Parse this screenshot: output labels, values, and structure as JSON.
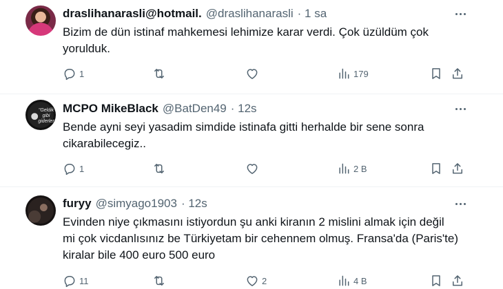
{
  "tweets": [
    {
      "name": "draslihanarasli@hotmail.",
      "handle": "@draslihanarasli",
      "time": "· 1 sa",
      "text_lines": [
        "Bizim de dün istinaf mahkemesi lehimize karar verdi. Çok üzüldüm çok",
        "yorulduk."
      ],
      "replies": "1",
      "retweets": "",
      "likes": "",
      "views": "179"
    },
    {
      "name": "MCPO MikeBlack",
      "handle": "@BatDen49",
      "time": "· 12s",
      "avatar_text": "\"Geldik gibi giderler",
      "text_lines": [
        "Bende ayni seyi yasadim simdide istinafa gitti herhalde bir sene sonra",
        "cikarabilecegiz.."
      ],
      "replies": "1",
      "retweets": "",
      "likes": "",
      "views": "2 B"
    },
    {
      "name": "furyy",
      "handle": "@simyago1903",
      "time": "· 12s",
      "text_lines": [
        "Evinden niye çıkmasını istiyordun şu anki kiranın 2 mislini almak için değil",
        "mi çok vicdanlısınız be Türkiyetam bir cehennem olmuş. Fransa'da (Paris'te)",
        "kiralar bile 400 euro 500 euro"
      ],
      "replies": "11",
      "retweets": "",
      "likes": "2",
      "views": "4 B"
    }
  ],
  "icons": {
    "reply": "reply-icon",
    "retweet": "retweet-icon",
    "like": "heart-icon",
    "views": "views-icon",
    "bookmark": "bookmark-icon",
    "share": "share-icon",
    "more": "more-icon"
  },
  "colors": {
    "text": "#0f1419",
    "secondary": "#536471",
    "divider": "#eff3f4"
  }
}
